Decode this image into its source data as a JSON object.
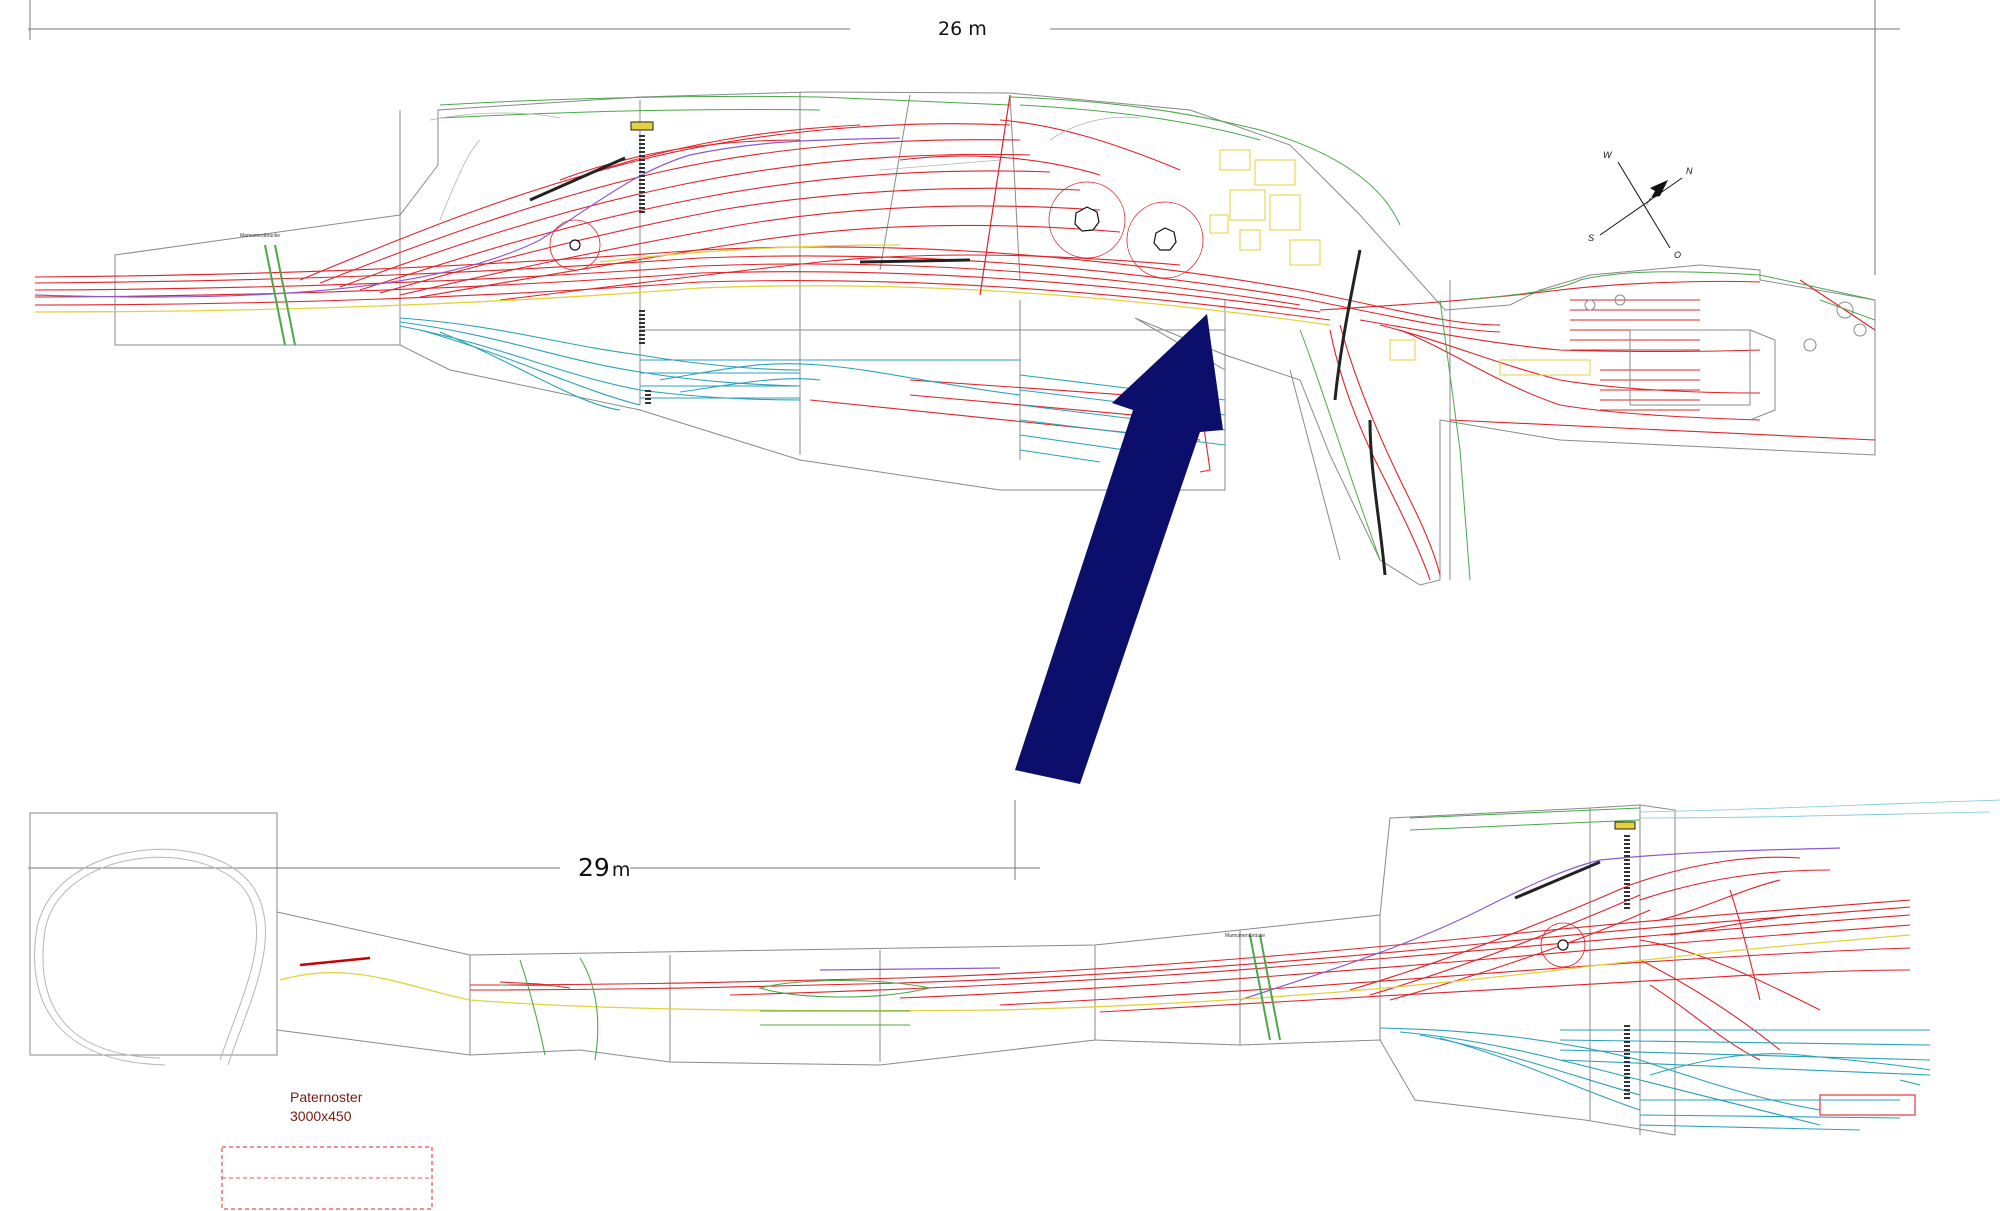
{
  "top_layout": {
    "dimension_label": "26 m",
    "bridge_label": "Mamumentbrücke"
  },
  "bottom_layout": {
    "dimension_label_number": "29",
    "dimension_label_unit": "m",
    "bridge_label": "Mamumentbrücke"
  },
  "compass": {
    "north": "N",
    "south": "S",
    "west": "W",
    "east": "O"
  },
  "paternoster": {
    "title": "Paternoster",
    "size": "3000x450"
  },
  "colors": {
    "arrow": "#0b0f6b",
    "mainline": "#e0232a",
    "yard": "#2ba2b8",
    "road": "#4aa84a",
    "yellow": "#e3d23c",
    "purple": "#8a5bd1",
    "outline": "#8a8a8a"
  }
}
